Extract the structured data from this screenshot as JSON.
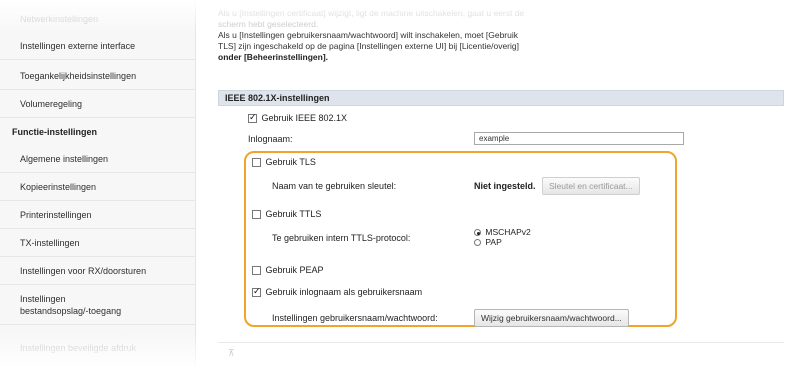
{
  "sidebar": {
    "items": [
      {
        "label": "Netwerkinstellingen",
        "faded": true
      },
      {
        "label": "Instellingen externe interface"
      },
      {
        "label": "Toegankelijkheidsinstellingen"
      },
      {
        "label": "Volumeregeling"
      },
      {
        "label": "Functie-instellingen",
        "heading": true
      },
      {
        "label": "Algemene instellingen"
      },
      {
        "label": "Kopieerinstellingen"
      },
      {
        "label": "Printerinstellingen"
      },
      {
        "label": "TX-instellingen"
      },
      {
        "label": "Instellingen voor RX/doorsturen"
      },
      {
        "label_line1": "Instellingen",
        "label_line2": "bestandsopslag/-toegang"
      },
      {
        "label": "Instellingen beveiligde afdruk",
        "faded": true
      }
    ]
  },
  "intro": {
    "faded_line1": "Als u [Instellingen certificaat] wijzigt, ligt de machine uitschakelen, gaat u eerst de",
    "faded_line2": "scherm hebt geselecteerd.",
    "line3": "Als u [Instellingen gebruikersnaam/wachtwoord] wilt inschakelen, moet [Gebruik",
    "line4": "TLS] zijn ingeschakeld op de pagina [Instellingen externe UI] bij [Licentie/overig]",
    "line5": "onder [Beheerinstellingen]."
  },
  "section": {
    "title": "IEEE 802.1X-instellingen",
    "use_ieee_label": "Gebruik IEEE 802.1X",
    "use_ieee_checked": true,
    "login_label": "Inlognaam:",
    "login_value": "example",
    "tls_label": "Gebruik TLS",
    "tls_checked": false,
    "key_label": "Naam van te gebruiken sleutel:",
    "key_status": "Niet ingesteld.",
    "key_button": "Sleutel en certificaat...",
    "ttls_label": "Gebruik TTLS",
    "ttls_checked": false,
    "ttls_protocol_label": "Te gebruiken intern TTLS-protocol:",
    "ttls_options": [
      "MSCHAPv2",
      "PAP"
    ],
    "ttls_selected": "MSCHAPv2",
    "peap_label": "Gebruik PEAP",
    "peap_checked": false,
    "use_login_label": "Gebruik inlognaam als gebruikersnaam",
    "use_login_checked": true,
    "credentials_label": "Instellingen gebruikersnaam/wachtwoord:",
    "credentials_button": "Wijzig gebruikersnaam/wachtwoord..."
  },
  "footer": {
    "top_glyph": "⊼"
  },
  "colors": {
    "highlight": "#f0a52a",
    "section_bar": "#dfe4ec"
  }
}
